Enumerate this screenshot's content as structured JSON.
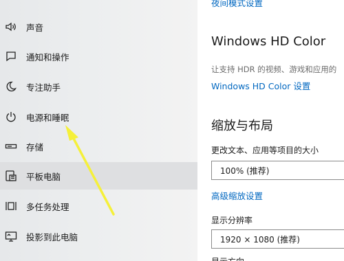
{
  "nav": {
    "items": [
      {
        "label": "声音",
        "icon": "speaker-icon"
      },
      {
        "label": "通知和操作",
        "icon": "notification-icon"
      },
      {
        "label": "专注助手",
        "icon": "moon-icon"
      },
      {
        "label": "电源和睡眠",
        "icon": "power-icon"
      },
      {
        "label": "存储",
        "icon": "storage-icon"
      },
      {
        "label": "平板电脑",
        "icon": "tablet-icon"
      },
      {
        "label": "多任务处理",
        "icon": "multitask-icon"
      },
      {
        "label": "投影到此电脑",
        "icon": "project-icon"
      }
    ],
    "selected_label": "平板电脑",
    "annotation_color": "#f5f03a"
  },
  "main": {
    "top_link_partial": "夜间模式设置",
    "hd_color": {
      "title": "Windows HD Color",
      "description": "让支持 HDR 的视频、游戏和应用的",
      "link": "Windows HD Color 设置"
    },
    "scale_layout": {
      "title": "缩放与布局",
      "text_size_label": "更改文本、应用等项目的大小",
      "text_size_value": "100% (推荐)",
      "advanced_link": "高级缩放设置",
      "resolution_label": "显示分辨率",
      "resolution_value": "1920 × 1080 (推荐)",
      "orientation_partial": "显示方向"
    }
  },
  "colors": {
    "accent": "#0067c0",
    "nav_background": "#eceeef",
    "selected_background": "#dedfe1"
  }
}
